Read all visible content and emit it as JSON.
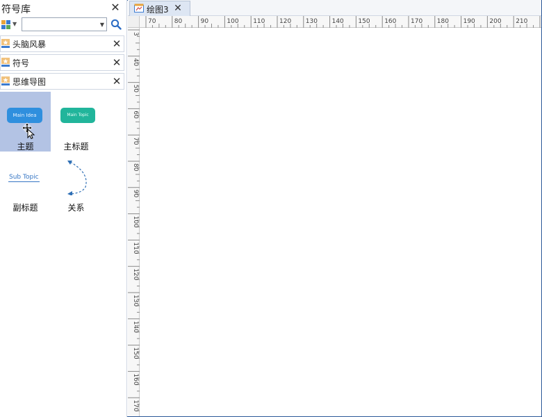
{
  "panel": {
    "title": "符号库",
    "search": {
      "value": "",
      "placeholder": ""
    },
    "categories": [
      {
        "label": "头脑风暴"
      },
      {
        "label": "符号"
      },
      {
        "label": "思维导图"
      }
    ],
    "symbols": [
      {
        "label": "主题",
        "shape_text": "Main Idea",
        "selected": true
      },
      {
        "label": "主标题",
        "shape_text": "Main Topic",
        "selected": false
      },
      {
        "label": "副标题",
        "shape_text": "Sub Topic",
        "selected": false
      },
      {
        "label": "关系",
        "shape_text": "",
        "selected": false
      }
    ]
  },
  "document": {
    "tab": {
      "label": "绘图3"
    }
  },
  "rulers": {
    "horizontal_labels": [
      "70",
      "80",
      "90",
      "100",
      "110",
      "120",
      "130",
      "140",
      "150",
      "160",
      "170",
      "180",
      "190",
      "200",
      "210"
    ],
    "vertical_labels": [
      "3",
      "40",
      "50",
      "60",
      "70",
      "80",
      "90",
      "100",
      "110",
      "120",
      "130",
      "140",
      "150",
      "160",
      "170"
    ]
  },
  "icons": {
    "panel_close": "close-icon",
    "library": "library-grid-icon",
    "search": "search-icon",
    "category": "star-folder-icon",
    "tab": "drawing-icon",
    "cursor": "move-cursor-icon"
  },
  "colors": {
    "accent": "#2b5797",
    "selected_bg": "#b3c3e4",
    "main_idea": "#2f8fde",
    "main_topic": "#21b59b",
    "sub_topic": "#3575c4",
    "relation": "#2f6fb5"
  }
}
